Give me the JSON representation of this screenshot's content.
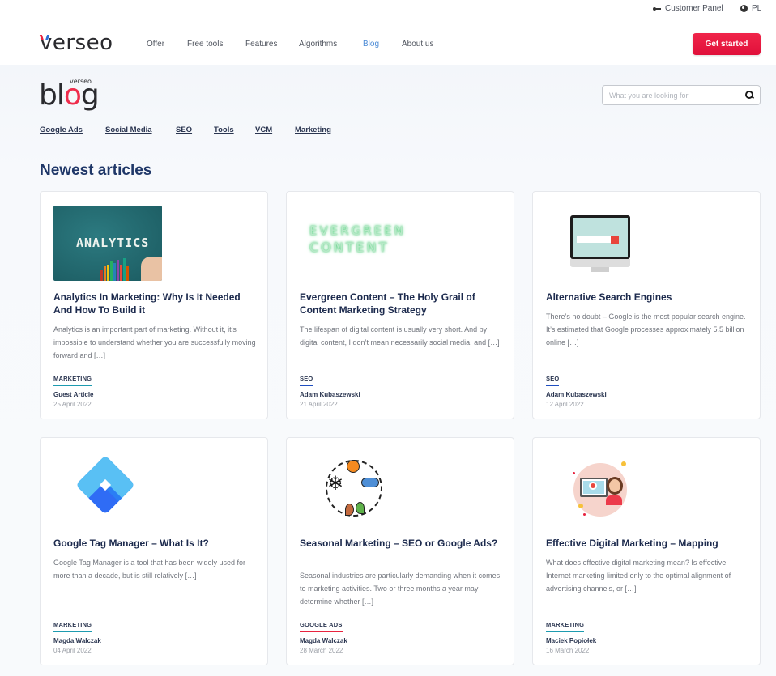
{
  "topbar": {
    "customer_panel": "Customer Panel",
    "language": "PL"
  },
  "nav": {
    "logo": "verseo",
    "links": [
      "Offer",
      "Free tools",
      "Features",
      "Algorithms",
      "Blog",
      "About us"
    ],
    "active": "Blog",
    "cta": "Get started"
  },
  "blog": {
    "logo_small": "verseo",
    "logo_big": "blog",
    "search_placeholder": "What you are looking for",
    "categories": [
      "Google Ads",
      "Social Media",
      "SEO",
      "Tools",
      "VCM",
      "Marketing"
    ],
    "section_title": "Newest articles"
  },
  "colors": {
    "accent_red": "#e8233f",
    "link_blue": "#4a8ad6",
    "title_navy": "#1f3768",
    "tag_marketing": "#1d9bb0",
    "tag_seo": "#1f4ec0",
    "tag_google_ads": "#e8233f"
  },
  "articles": [
    {
      "image": "analytics-chalkboard",
      "image_text": "ANALYTICS",
      "title": "Analytics In Marketing: Why Is It Needed And How To Build it",
      "excerpt": "Analytics is an important part of marketing. Without it, it’s impossible to understand whether you are successfully moving forward and […]",
      "tag": "MARKETING",
      "author": "Guest Article",
      "date": "25 April 2022"
    },
    {
      "image": "evergreen-content-neon",
      "image_text_1": "EVERGREEN",
      "image_text_2": "CONTENT",
      "title": "Evergreen Content – The Holy Grail of Content Marketing Strategy",
      "excerpt": "The lifespan of digital content is usually very short. And by digital content, I don’t mean necessarily social media, and […]",
      "tag": "SEO",
      "author": "Adam Kubaszewski",
      "date": "21 April 2022"
    },
    {
      "image": "monitor-search",
      "title": "Alternative Search Engines",
      "excerpt": "There’s no doubt – Google is the most popular search engine. It’s estimated that Google processes approximately 5.5 billion online […]",
      "tag": "SEO",
      "author": "Adam Kubaszewski",
      "date": "12 April 2022"
    },
    {
      "image": "google-tag-manager-logo",
      "title": "Google Tag Manager – What Is It?",
      "excerpt": "Google Tag Manager is a tool that has been widely used for more than a decade, but is still relatively […]",
      "tag": "MARKETING",
      "author": "Magda Walczak",
      "date": "04 April 2022"
    },
    {
      "image": "seasons-icon",
      "title": "Seasonal Marketing – SEO or Google Ads?",
      "excerpt": "Seasonal industries are particularly demanding when it comes to marketing activities. Two or three months a year may determine whether […]",
      "tag": "GOOGLE ADS",
      "author": "Magda Walczak",
      "date": "28 March 2022"
    },
    {
      "image": "digital-marketing-illustration",
      "title": "Effective Digital Marketing – Mapping",
      "excerpt": "What does effective digital marketing mean? Is effective Internet marketing limited only to the optimal alignment of advertising channels, or […]",
      "tag": "MARKETING",
      "author": "Maciek Popiołek",
      "date": "16 March 2022"
    }
  ]
}
